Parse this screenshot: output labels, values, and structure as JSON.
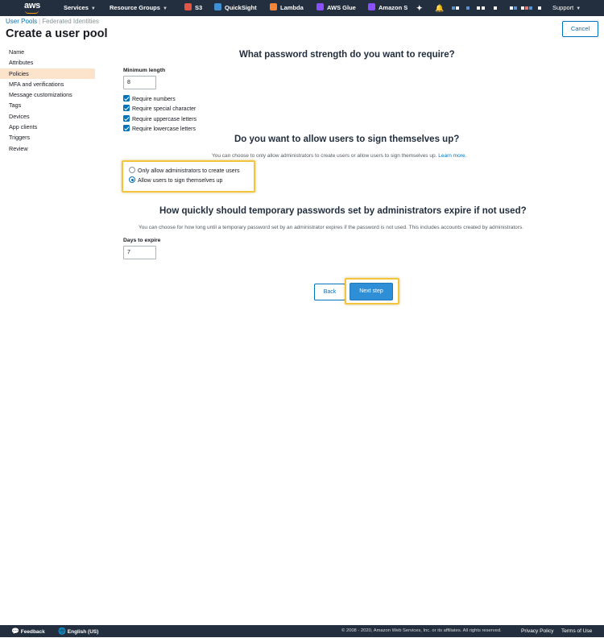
{
  "topnav": {
    "logo": "aws",
    "services": "Services",
    "resource_groups": "Resource Groups",
    "shortcuts": [
      {
        "label": "S3",
        "color": "#e25444",
        "icon": "s3-icon"
      },
      {
        "label": "QuickSight",
        "color": "#3f8fd2",
        "icon": "quicksight-icon"
      },
      {
        "label": "Lambda",
        "color": "#f58536",
        "icon": "lambda-icon"
      },
      {
        "label": "AWS Glue",
        "color": "#8c4fff",
        "icon": "glue-icon"
      },
      {
        "label": "Amazon S",
        "color": "#8c4fff",
        "icon": "amazon-s-icon"
      }
    ],
    "support": "Support"
  },
  "breadcrumb": {
    "user_pools": "User Pools",
    "separator": "|",
    "federated": "Federated Identities"
  },
  "page_title": "Create a user pool",
  "cancel_label": "Cancel",
  "sidebar": {
    "items": [
      {
        "label": "Name"
      },
      {
        "label": "Attributes"
      },
      {
        "label": "Policies"
      },
      {
        "label": "MFA and verifications"
      },
      {
        "label": "Message customizations"
      },
      {
        "label": "Tags"
      },
      {
        "label": "Devices"
      },
      {
        "label": "App clients"
      },
      {
        "label": "Triggers"
      },
      {
        "label": "Review"
      }
    ],
    "active": "Policies"
  },
  "password": {
    "heading": "What password strength do you want to require?",
    "min_length_label": "Minimum length",
    "min_length_value": "8",
    "checkboxes": [
      {
        "label": "Require numbers",
        "checked": true
      },
      {
        "label": "Require special character",
        "checked": true
      },
      {
        "label": "Require uppercase letters",
        "checked": true
      },
      {
        "label": "Require lowercase letters",
        "checked": true
      }
    ]
  },
  "signup": {
    "heading": "Do you want to allow users to sign themselves up?",
    "description": "You can choose to only allow administrators to create users or allow users to sign themselves up.",
    "learn_more": "Learn more.",
    "options": [
      {
        "label": "Only allow administrators to create users",
        "selected": false
      },
      {
        "label": "Allow users to sign themselves up",
        "selected": true
      }
    ]
  },
  "expiry": {
    "heading": "How quickly should temporary passwords set by administrators expire if not used?",
    "description": "You can choose for how long until a temporary password set by an administrator expires if the password is not used. This includes accounts created by administrators.",
    "days_label": "Days to expire",
    "days_value": "7"
  },
  "buttons": {
    "back": "Back",
    "next": "Next step"
  },
  "footer": {
    "feedback": "Feedback",
    "language": "English (US)",
    "copyright": "© 2008 - 2020, Amazon Web Services, Inc. or its affiliates. All rights reserved.",
    "privacy": "Privacy Policy",
    "terms": "Terms of Use"
  },
  "colors": {
    "nav_bg": "#232f3e",
    "accent": "#0073bb",
    "highlight": "#f2c53d",
    "active_sidebar": "#fbe3cc"
  }
}
